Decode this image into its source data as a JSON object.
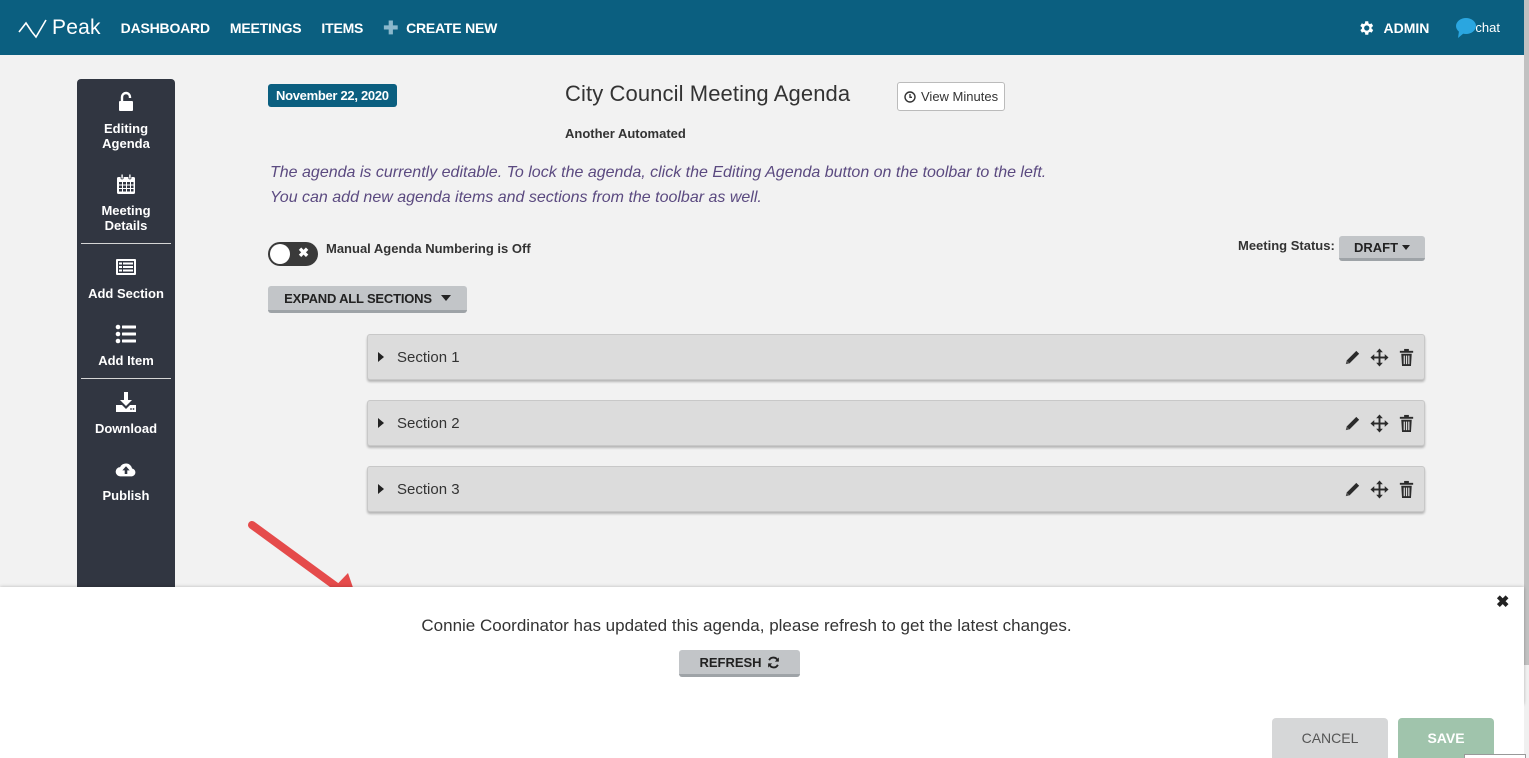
{
  "app": {
    "brand": "Peak",
    "nav": [
      {
        "label": "DASHBOARD"
      },
      {
        "label": "MEETINGS"
      },
      {
        "label": "ITEMS"
      },
      {
        "label": "CREATE NEW",
        "icon": "plus-icon"
      }
    ],
    "admin_label": "ADMIN",
    "chat_label": "chat",
    "colors": {
      "brand": "#0b5f80",
      "toolbar": "#313641",
      "info_text": "#5b4a80",
      "save": "#a0c4ac",
      "annotation_arrow": "#e54b4b"
    }
  },
  "toolbar": {
    "items": [
      {
        "label_line1": "Editing",
        "label_line2": "Agenda",
        "icon": "unlock-icon"
      },
      {
        "label_line1": "Meeting",
        "label_line2": "Details",
        "icon": "calendar-icon"
      },
      {
        "label_line1": "Add Section",
        "label_line2": "",
        "icon": "section-list-icon"
      },
      {
        "label_line1": "Add Item",
        "label_line2": "",
        "icon": "list-icon"
      },
      {
        "label_line1": "Download",
        "label_line2": "",
        "icon": "download-icon"
      },
      {
        "label_line1": "Publish",
        "label_line2": "",
        "icon": "cloud-upload-icon"
      }
    ]
  },
  "meeting": {
    "date": "November 22, 2020",
    "title": "City Council Meeting Agenda",
    "view_minutes_label": "View Minutes",
    "subtitle": "Another Automated",
    "info_line1": "The agenda is currently editable. To lock the agenda, click the Editing Agenda button on the toolbar to the left.",
    "info_line2": "You can add new agenda items and sections from the toolbar as well.",
    "numbering_toggle": {
      "label": "Manual Agenda Numbering is Off",
      "on": false
    },
    "status_label": "Meeting Status:",
    "status_value": "DRAFT",
    "expand_all_label": "EXPAND ALL SECTIONS",
    "sections": [
      {
        "title": "Section 1"
      },
      {
        "title": "Section 2"
      },
      {
        "title": "Section 3"
      }
    ]
  },
  "notification": {
    "message": "Connie Coordinator has updated this agenda, please refresh to get the latest changes.",
    "refresh_label": "REFRESH",
    "close_symbol": "✖"
  },
  "footer": {
    "cancel_label": "CANCEL",
    "save_label": "SAVE"
  }
}
